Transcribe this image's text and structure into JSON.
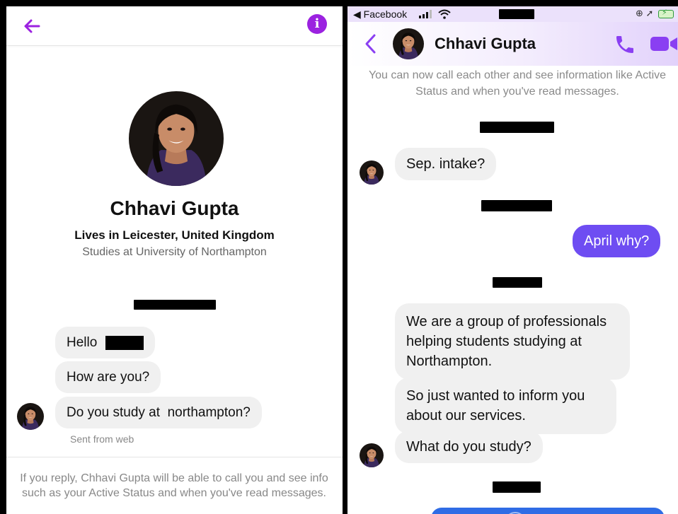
{
  "colors": {
    "accent_purple": "#9b22e0",
    "my_bubble": "#6e4df2",
    "their_bubble": "#f0f0f0",
    "muted_text": "#888888"
  },
  "left": {
    "header": {
      "back_icon": "back-arrow-icon",
      "info_icon": "info-icon",
      "info_glyph": "i"
    },
    "profile": {
      "name": "Chhavi Gupta",
      "lives": "Lives in Leicester, United Kingdom",
      "studies": "Studies at University of Northampton"
    },
    "messages": [
      {
        "text": "Hello"
      },
      {
        "text": "How are you?"
      },
      {
        "text": "Do you study at  northampton?"
      }
    ],
    "sent_from": "Sent from web",
    "footer": "If you reply, Chhavi Gupta will be able to call you and see info such as your Active Status and when you've read messages."
  },
  "right": {
    "status_bar": {
      "back_label": "◀ Facebook"
    },
    "header": {
      "name": "Chhavi Gupta",
      "call_icon": "phone-icon",
      "video_icon": "video-camera-icon"
    },
    "notice": "You can now call each other and see information like Active Status and when you've read messages.",
    "messages": [
      {
        "from": "them",
        "text": "Sep. intake?"
      },
      {
        "from": "me",
        "text": "April why?"
      },
      {
        "from": "them",
        "text": "We are a group of professionals helping students studying at Northampton."
      },
      {
        "from": "them",
        "text": "So just wanted to inform you about our services."
      },
      {
        "from": "them",
        "text": "What do you study?"
      }
    ]
  }
}
